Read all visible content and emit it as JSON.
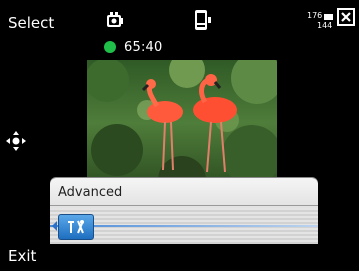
{
  "softkeys": {
    "left": "Select",
    "right": "Exit"
  },
  "status_icons": [
    "camera-mode-icon",
    "phone-icon",
    "resolution-icon",
    "close-icon"
  ],
  "resolution_label": {
    "top": "176",
    "bottom": "144"
  },
  "recording": {
    "time": "65:40",
    "indicator_color": "#1fbf4a"
  },
  "panel": {
    "title": "Advanced",
    "item_icon": "tools-icon"
  },
  "colors": {
    "accent": "#2a6fc8",
    "background": "#000000"
  }
}
